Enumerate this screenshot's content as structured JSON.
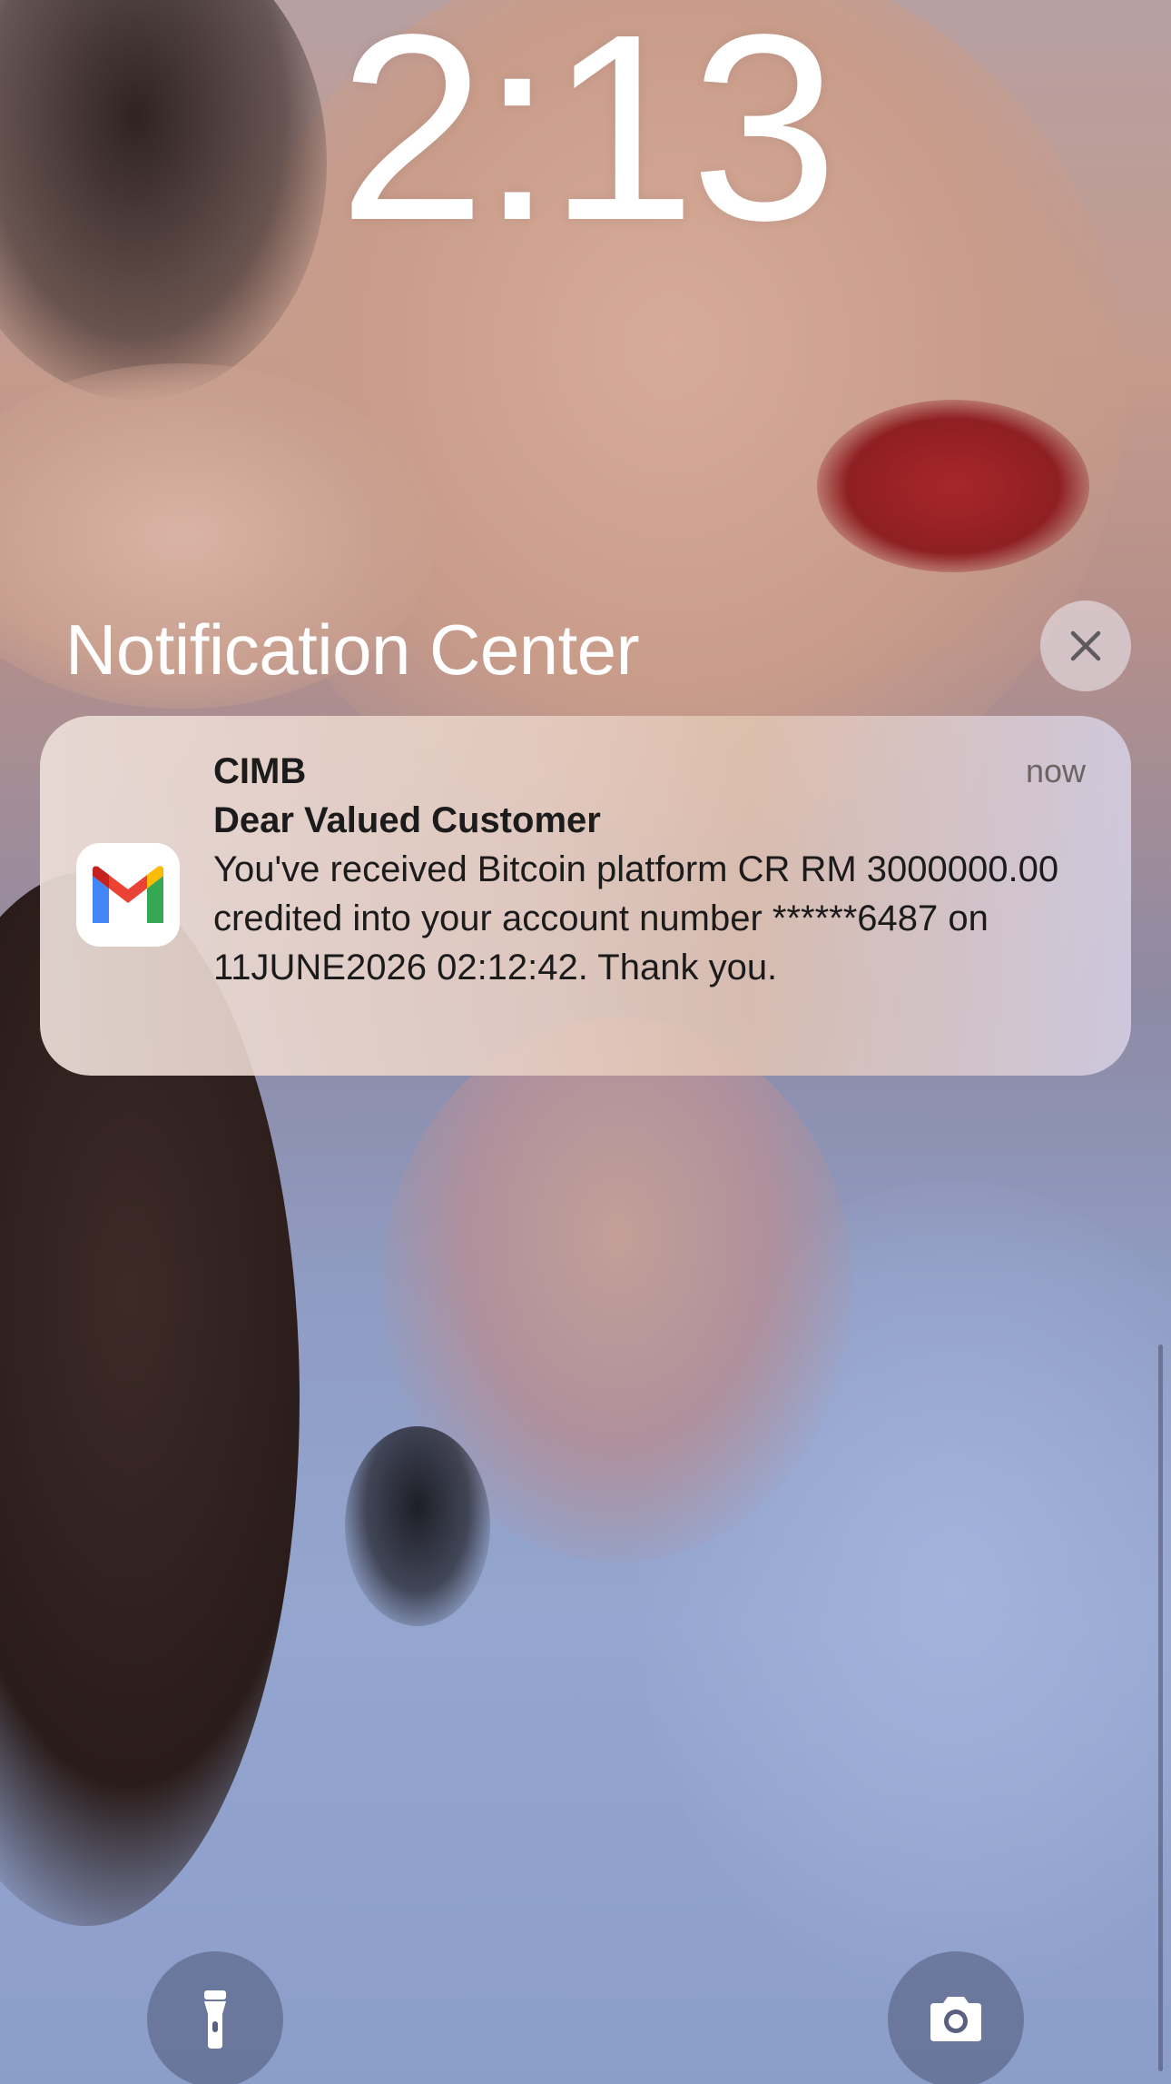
{
  "lockscreen": {
    "time": "2:13"
  },
  "notification_center": {
    "title": "Notification Center",
    "close_icon": "close-icon"
  },
  "notification": {
    "app_icon": "gmail-icon",
    "sender": "CIMB",
    "subject": "Dear Valued Customer",
    "message": "You've received Bitcoin platform CR RM 3000000.00 credited into your account number ******6487 on 11JUNE2026 02:12:42. Thank you.",
    "timestamp": "now"
  },
  "quick_actions": {
    "left_icon": "flashlight-icon",
    "right_icon": "camera-icon"
  },
  "colors": {
    "gmail_red": "#EA4335",
    "gmail_blue": "#4285F4",
    "gmail_green": "#34A853",
    "gmail_yellow": "#FBBC04"
  }
}
